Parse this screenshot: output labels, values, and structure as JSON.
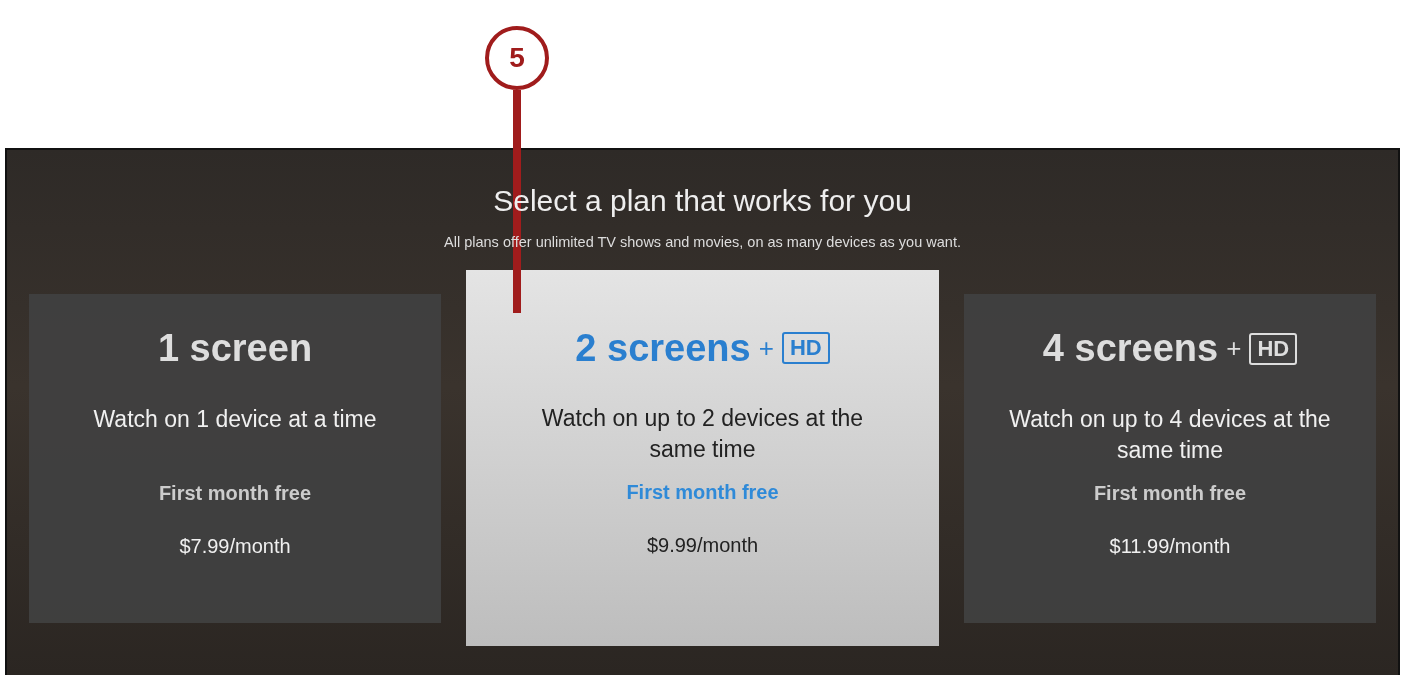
{
  "callout": {
    "number": "5"
  },
  "screen": {
    "title": "Select a plan that works for you",
    "subtitle": "All plans offer unlimited TV shows and movies, on as many devices as you want."
  },
  "plans": [
    {
      "name": "1 screen",
      "description": "Watch on 1 device at a time",
      "offer": "First month free",
      "price": "$7.99/month",
      "selected": false
    },
    {
      "name": "2 screens",
      "plus": "+",
      "badge": "HD",
      "description": "Watch on up to 2 devices at the same time",
      "offer": "First month free",
      "price": "$9.99/month",
      "selected": true
    },
    {
      "name": "4 screens",
      "plus": "+",
      "badge": "HD",
      "description": "Watch on up to 4 devices at the same time",
      "offer": "First month free",
      "price": "$11.99/month",
      "selected": false
    }
  ]
}
